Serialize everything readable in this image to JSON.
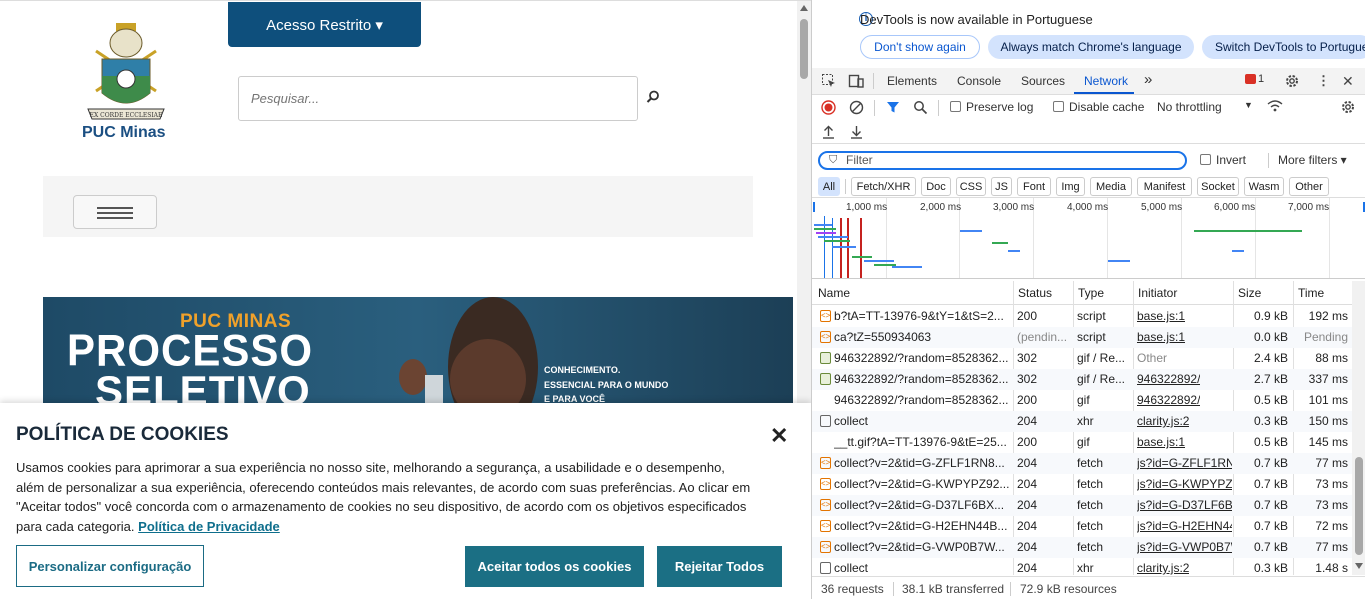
{
  "site": {
    "logo_text": "PUC Minas",
    "restricted_button": "Acesso Restrito ▾",
    "search_placeholder": "Pesquisar...",
    "banner": {
      "brand": "PUC MINAS",
      "headline_1": "PROCESSO",
      "headline_2": "SELETIVO",
      "tag_1": "CONHECIMENTO.",
      "tag_2": "ESSENCIAL PARA O MUNDO",
      "tag_3": "E PARA VOCÊ"
    },
    "cookie": {
      "title": "POLÍTICA DE COOKIES",
      "close": "✕",
      "body": "Usamos cookies para aprimorar a sua experiência no nosso site, melhorando a segurança, a usabilidade e o desempenho, além de personalizar a sua experiência, oferecendo conteúdos mais relevantes, de acordo com suas preferências. Ao clicar em \"Aceitar todos\" você concorda com o armazenamento de cookies no seu dispositivo, de acordo com os objetivos especificados para cada categoria.",
      "privacy_link": "Política de Privacidade",
      "btn_customize": "Personalizar configuração",
      "btn_accept": "Aceitar todos os cookies",
      "btn_reject": "Rejeitar Todos"
    }
  },
  "devtools": {
    "info": {
      "icon": "i",
      "message": "DevTools is now available in Portuguese",
      "btn_dont_show": "Don't show again",
      "btn_match": "Always match Chrome's language",
      "btn_switch": "Switch DevTools to Portuguese"
    },
    "tabs": [
      "Elements",
      "Console",
      "Sources",
      "Network"
    ],
    "active_tab": "Network",
    "more_tabs": "»",
    "error_count": "1",
    "toolbar": {
      "preserve_log": "Preserve log",
      "disable_cache": "Disable cache",
      "throttling": "No throttling"
    },
    "filter": {
      "placeholder": "Filter",
      "invert": "Invert",
      "more_filters": "More filters ▾"
    },
    "type_filters": [
      "All",
      "Fetch/XHR",
      "Doc",
      "CSS",
      "JS",
      "Font",
      "Img",
      "Media",
      "Manifest",
      "Socket",
      "Wasm",
      "Other"
    ],
    "timeline_labels": [
      "1,000 ms",
      "2,000 ms",
      "3,000 ms",
      "4,000 ms",
      "5,000 ms",
      "6,000 ms",
      "7,000 ms"
    ],
    "columns": [
      "Name",
      "Status",
      "Type",
      "Initiator",
      "Size",
      "Time"
    ],
    "rows": [
      {
        "icon": "script",
        "name": "b?tA=TT-13976-9&tY=1&tS=2...",
        "status": "200",
        "type": "script",
        "initiator": "base.js:1",
        "size": "0.9 kB",
        "time": "192 ms"
      },
      {
        "icon": "script",
        "name": "ca?tZ=550934063",
        "status": "(pendin...",
        "type": "script",
        "initiator": "base.js:1",
        "size": "0.0 kB",
        "time": "Pending"
      },
      {
        "icon": "img",
        "name": "946322892/?random=8528362...",
        "status": "302",
        "type": "gif / Re...",
        "initiator": "Other",
        "size": "2.4 kB",
        "time": "88 ms"
      },
      {
        "icon": "img",
        "name": "946322892/?random=8528362...",
        "status": "302",
        "type": "gif / Re...",
        "initiator": "946322892/",
        "size": "2.7 kB",
        "time": "337 ms"
      },
      {
        "icon": "none",
        "name": "946322892/?random=8528362...",
        "status": "200",
        "type": "gif",
        "initiator": "946322892/",
        "size": "0.5 kB",
        "time": "101 ms"
      },
      {
        "icon": "doc",
        "name": "collect",
        "status": "204",
        "type": "xhr",
        "initiator": "clarity.js:2",
        "size": "0.3 kB",
        "time": "150 ms"
      },
      {
        "icon": "none",
        "name": "__tt.gif?tA=TT-13976-9&tE=25...",
        "status": "200",
        "type": "gif",
        "initiator": "base.js:1",
        "size": "0.5 kB",
        "time": "145 ms"
      },
      {
        "icon": "script",
        "name": "collect?v=2&tid=G-ZFLF1RN8...",
        "status": "204",
        "type": "fetch",
        "initiator": "js?id=G-ZFLF1RN8",
        "size": "0.7 kB",
        "time": "77 ms"
      },
      {
        "icon": "script",
        "name": "collect?v=2&tid=G-KWPYPZ92...",
        "status": "204",
        "type": "fetch",
        "initiator": "js?id=G-KWPYPZ9",
        "size": "0.7 kB",
        "time": "73 ms"
      },
      {
        "icon": "script",
        "name": "collect?v=2&tid=G-D37LF6BX...",
        "status": "204",
        "type": "fetch",
        "initiator": "js?id=G-D37LF6BX",
        "size": "0.7 kB",
        "time": "73 ms"
      },
      {
        "icon": "script",
        "name": "collect?v=2&tid=G-H2EHN44B...",
        "status": "204",
        "type": "fetch",
        "initiator": "js?id=G-H2EHN44",
        "size": "0.7 kB",
        "time": "72 ms"
      },
      {
        "icon": "script",
        "name": "collect?v=2&tid=G-VWP0B7W...",
        "status": "204",
        "type": "fetch",
        "initiator": "js?id=G-VWP0B7W",
        "size": "0.7 kB",
        "time": "77 ms"
      },
      {
        "icon": "doc",
        "name": "collect",
        "status": "204",
        "type": "xhr",
        "initiator": "clarity.js:2",
        "size": "0.3 kB",
        "time": "1.48 s"
      }
    ],
    "status_bar": {
      "requests": "36 requests",
      "transferred": "38.1 kB transferred",
      "resources": "72.9 kB resources"
    }
  }
}
